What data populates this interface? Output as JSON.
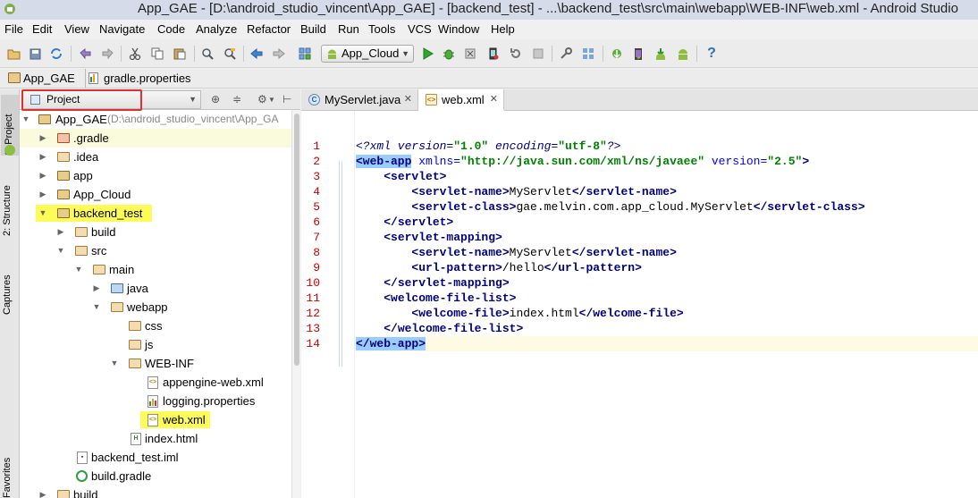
{
  "window": {
    "title": "App_GAE - [D:\\android_studio_vincent\\App_GAE] - [backend_test] - ...\\backend_test\\src\\main\\webapp\\WEB-INF\\web.xml - Android Studio"
  },
  "menu": [
    "File",
    "Edit",
    "View",
    "Navigate",
    "Code",
    "Analyze",
    "Refactor",
    "Build",
    "Run",
    "Tools",
    "VCS",
    "Window",
    "Help"
  ],
  "toolbar": {
    "run_config": "App_Cloud",
    "help_glyph": "?"
  },
  "breadcrumbs": [
    "App_GAE",
    "gradle.properties"
  ],
  "side_tabs": [
    "1: Project",
    "2: Structure",
    "Captures",
    "Favorites"
  ],
  "project_panel": {
    "view_label": "Project",
    "tree": [
      {
        "label": "App_GAE",
        "suffix": "(D:\\android_studio_vincent\\App_GA",
        "icon": "module-folder-icon"
      },
      {
        "label": ".gradle",
        "icon": "folder-icon"
      },
      {
        "label": ".idea",
        "icon": "folder-icon"
      },
      {
        "label": "app",
        "icon": "module-folder-icon"
      },
      {
        "label": "App_Cloud",
        "icon": "module-folder-icon"
      },
      {
        "label": "backend_test",
        "icon": "module-folder-icon"
      },
      {
        "label": "build",
        "icon": "folder-icon"
      },
      {
        "label": "src",
        "icon": "folder-icon"
      },
      {
        "label": "main",
        "icon": "folder-icon"
      },
      {
        "label": "java",
        "icon": "source-folder-icon"
      },
      {
        "label": "webapp",
        "icon": "folder-icon"
      },
      {
        "label": "css",
        "icon": "folder-icon"
      },
      {
        "label": "js",
        "icon": "folder-icon"
      },
      {
        "label": "WEB-INF",
        "icon": "folder-icon"
      },
      {
        "label": "appengine-web.xml",
        "icon": "xml-file-icon"
      },
      {
        "label": "logging.properties",
        "icon": "properties-file-icon"
      },
      {
        "label": "web.xml",
        "icon": "xml-file-icon"
      },
      {
        "label": "index.html",
        "icon": "html-file-icon"
      },
      {
        "label": "backend_test.iml",
        "icon": "iml-file-icon"
      },
      {
        "label": "build.gradle",
        "icon": "gradle-file-icon"
      },
      {
        "label": "build",
        "icon": "folder-icon"
      }
    ]
  },
  "editor": {
    "tabs": [
      {
        "label": "MyServlet.java",
        "icon": "java-class-icon",
        "icon_glyph": "C"
      },
      {
        "label": "web.xml",
        "icon": "xml-file-icon",
        "icon_glyph": "<>"
      }
    ],
    "line_numbers": [
      "1",
      "2",
      "3",
      "4",
      "5",
      "6",
      "7",
      "8",
      "9",
      "10",
      "11",
      "12",
      "13",
      "14"
    ],
    "code": {
      "l1_a": "<?xml version=",
      "l1_b": "\"1.0\"",
      "l1_c": " encoding=",
      "l1_d": "\"utf-8\"",
      "l1_e": "?>",
      "l2_a": "<web-app",
      "l2_b": " xmlns=",
      "l2_c": "\"http://java.sun.com/xml/ns/javaee\"",
      "l2_d": " version=",
      "l2_e": "\"2.5\"",
      "l2_f": ">",
      "l3": "<servlet>",
      "l4_a": "<servlet-name>",
      "l4_b": "MyServlet",
      "l4_c": "</servlet-name>",
      "l5_a": "<servlet-class>",
      "l5_b": "gae.melvin.com.app_cloud.MyServlet",
      "l5_c": "</servlet-class>",
      "l6": "</servlet>",
      "l7": "<servlet-mapping>",
      "l8_a": "<servlet-name>",
      "l8_b": "MyServlet",
      "l8_c": "</servlet-name>",
      "l9_a": "<url-pattern>",
      "l9_b": "/hello",
      "l9_c": "</url-pattern>",
      "l10": "</servlet-mapping>",
      "l11": "<welcome-file-list>",
      "l12_a": "<welcome-file>",
      "l12_b": "index.html",
      "l12_c": "</welcome-file>",
      "l13": "</welcome-file-list>",
      "l14": "</web-app>"
    }
  }
}
